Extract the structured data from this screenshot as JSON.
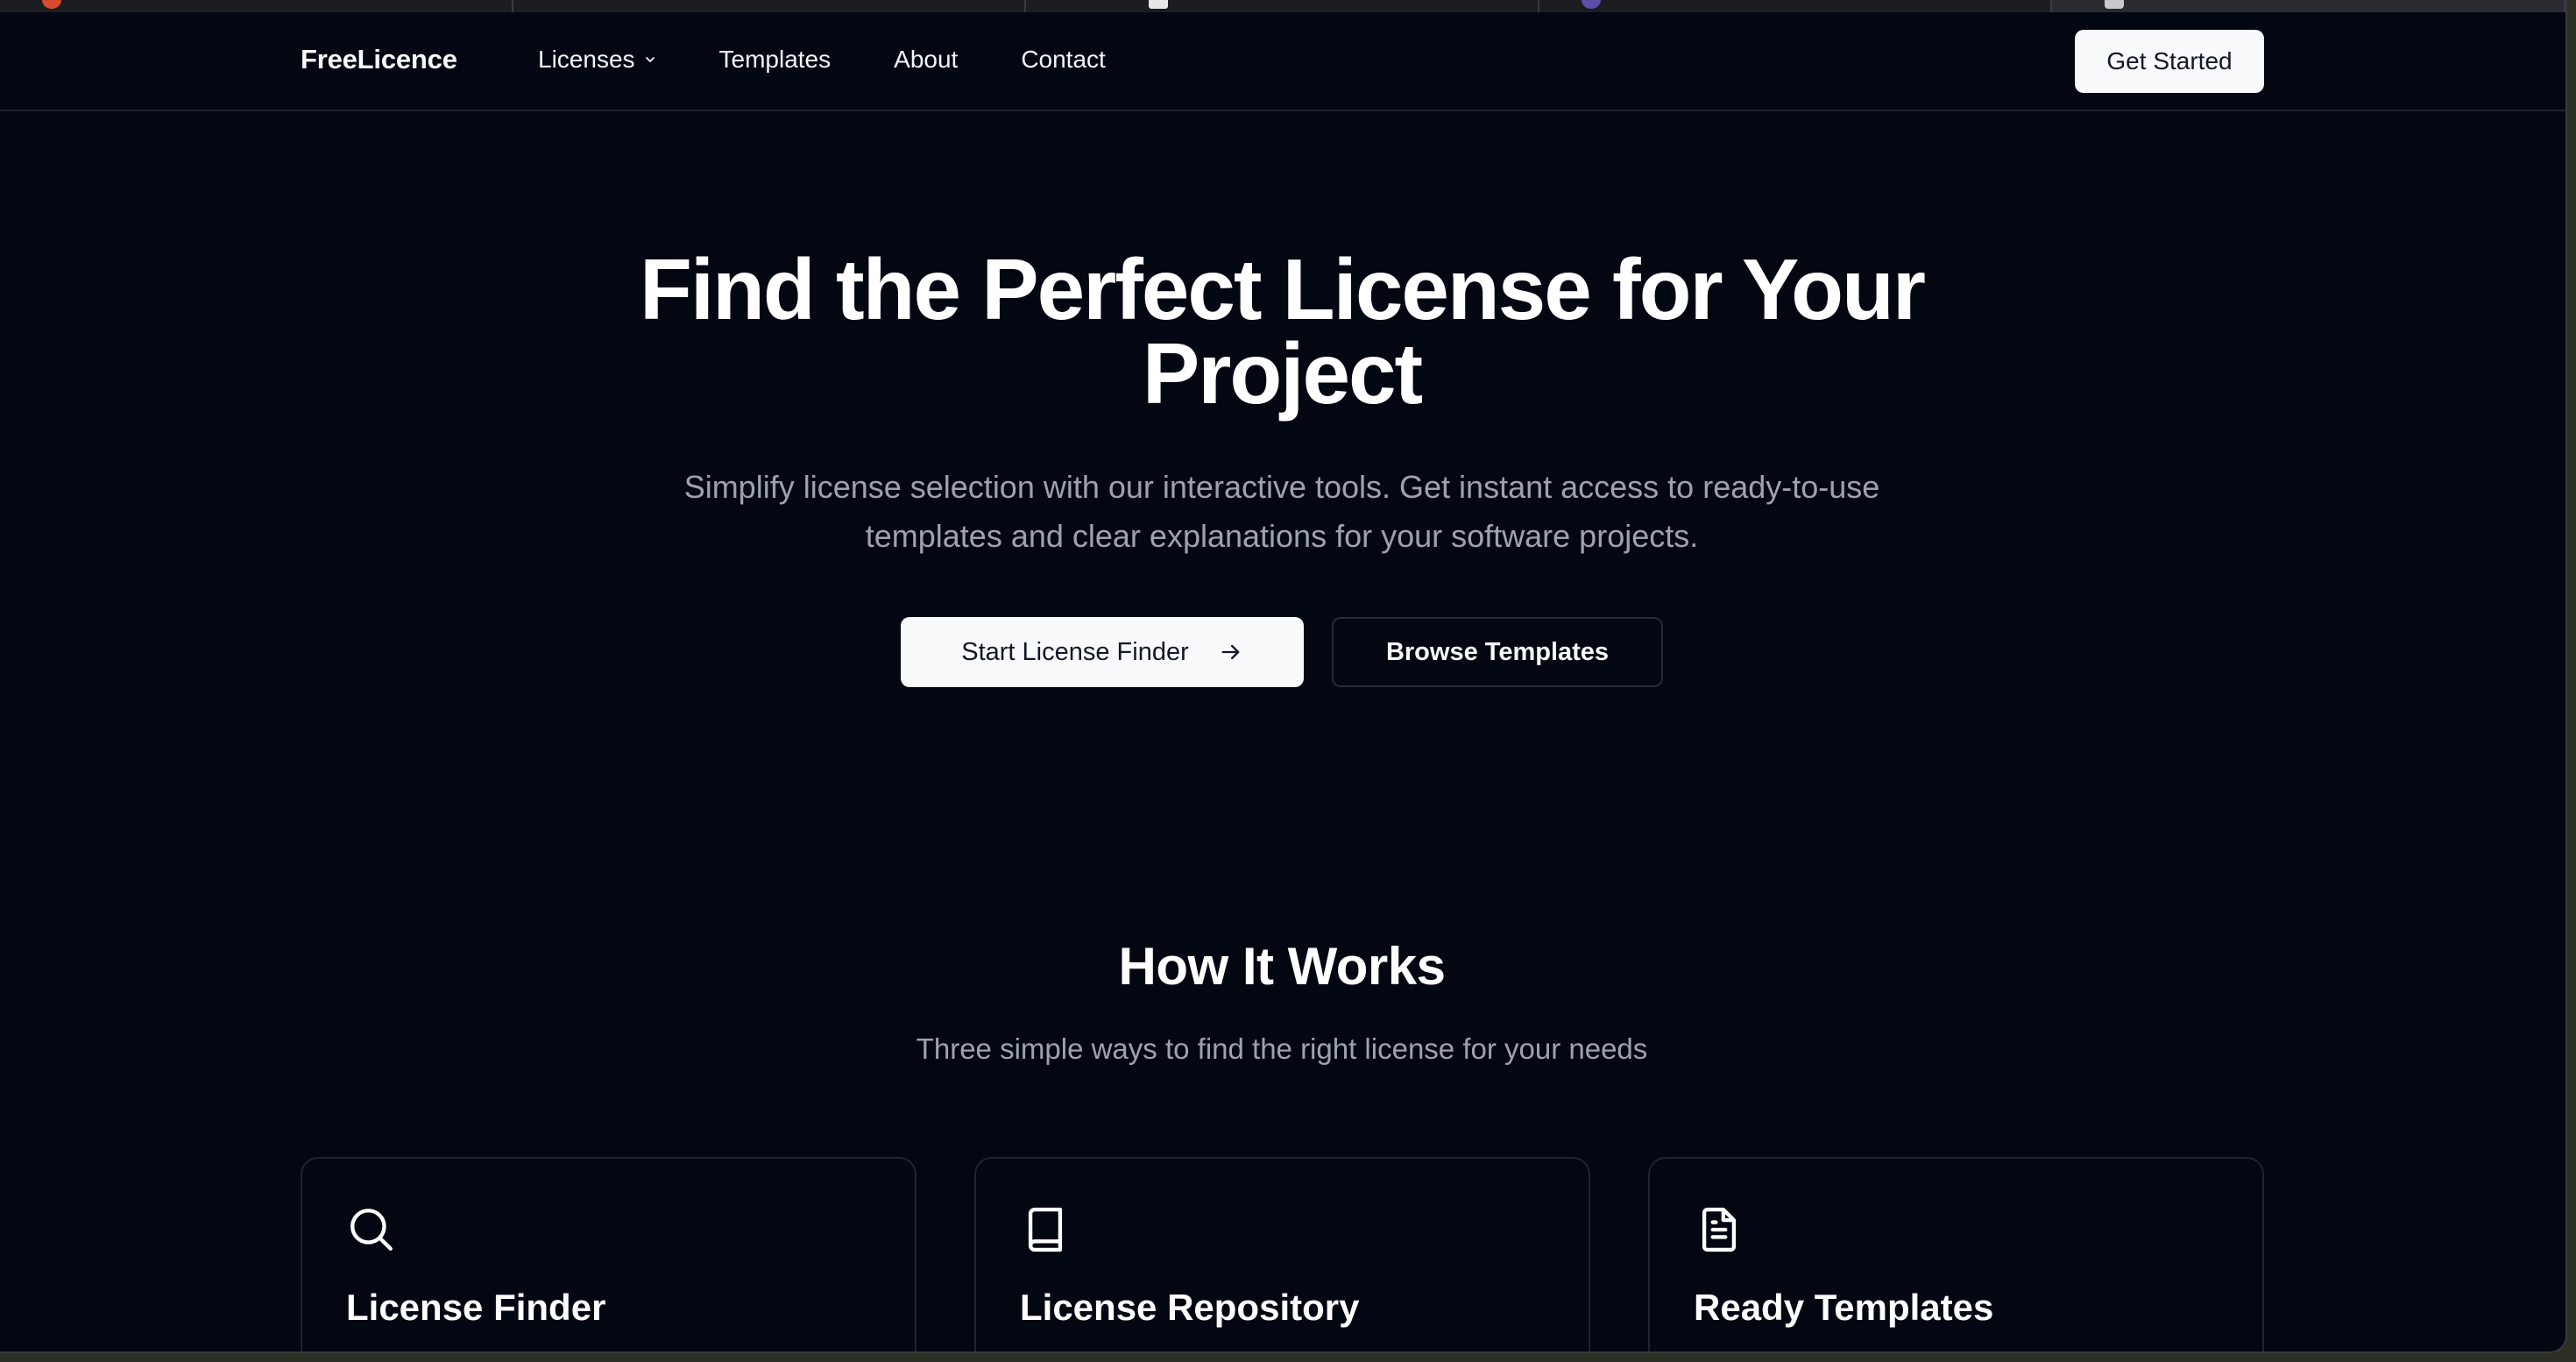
{
  "nav": {
    "brand": "FreeLicence",
    "links": [
      {
        "label": "Licenses",
        "has_dropdown": true
      },
      {
        "label": "Templates"
      },
      {
        "label": "About"
      },
      {
        "label": "Contact"
      }
    ],
    "cta": "Get Started"
  },
  "hero": {
    "title_line1": "Find the Perfect License for Your",
    "title_line2": "Project",
    "subtitle_line1": "Simplify license selection with our interactive tools. Get instant access to ready-to-use",
    "subtitle_line2": "templates and clear explanations for your software projects.",
    "primary_button": "Start License Finder",
    "secondary_button": "Browse Templates"
  },
  "how_it_works": {
    "title": "How It Works",
    "subtitle": "Three simple ways to find the right license for your needs",
    "cards": [
      {
        "title": "License Finder",
        "icon": "search-icon"
      },
      {
        "title": "License Repository",
        "icon": "book-icon"
      },
      {
        "title": "Ready Templates",
        "icon": "file-text-icon"
      }
    ]
  },
  "colors": {
    "background": "#030712",
    "text_primary": "#ffffff",
    "text_muted": "#9ca3af",
    "button_light": "#f9fafb",
    "border": "#1f2430"
  }
}
